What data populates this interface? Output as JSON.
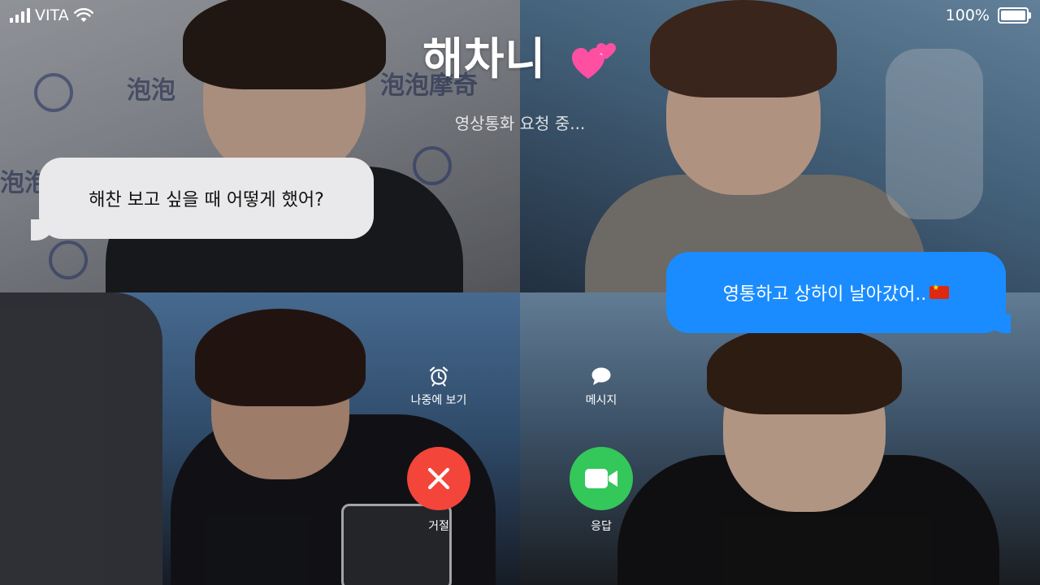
{
  "status_bar": {
    "carrier": "VITA",
    "battery": "100%",
    "battery_level": 1.0
  },
  "call": {
    "caller_name": "해차니",
    "heart_icon": "two-hearts-icon",
    "status_text": "영상통화 요청 중..."
  },
  "messages": {
    "received": "해찬 보고 싶을 때 어떻게 했어?",
    "sent": "영통하고 상하이 날아갔어..",
    "sent_flag_icon": "china-flag-icon"
  },
  "controls": {
    "remind_label": "나중에 보기",
    "remind_icon": "alarm-clock-icon",
    "message_label": "메시지",
    "message_icon": "speech-bubble-icon",
    "decline_label": "거절",
    "decline_icon": "close-icon",
    "accept_label": "응답",
    "accept_icon": "video-camera-icon"
  },
  "colors": {
    "decline": "#f4453a",
    "accept": "#34c759",
    "sent_bubble": "#1a8cff",
    "received_bubble": "#e9e9eb"
  }
}
